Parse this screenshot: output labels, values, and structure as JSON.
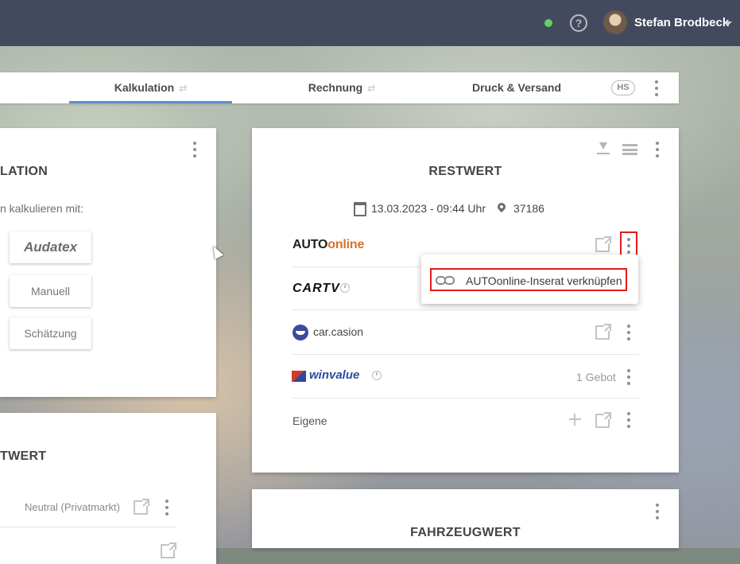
{
  "header": {
    "user_name": "Stefan Brodbeck",
    "help_symbol": "?",
    "status_color": "#5fd35f"
  },
  "tabs": [
    {
      "label": "Kalkulation",
      "icon": "⇄",
      "active": true
    },
    {
      "label": "Rechnung",
      "icon": "⇄",
      "active": false
    },
    {
      "label": "Druck & Versand",
      "active": false
    }
  ],
  "tabbar": {
    "badge": "HS"
  },
  "kalkulation_card": {
    "title": "LATION",
    "subtitle": "n kalkulieren mit:",
    "buttons": [
      "Audatex",
      "Manuell",
      "Schätzung"
    ]
  },
  "restwert_lower_card": {
    "title": "TWERT",
    "row_label": "Neutral (Privatmarkt)"
  },
  "restwert_card": {
    "title": "RESTWERT",
    "date": "13.03.2023 - 09:44 Uhr",
    "postal_code": "37186",
    "providers": [
      {
        "name_part1": "AUTO",
        "name_part2": "online"
      },
      {
        "name": "CARTV"
      },
      {
        "name": "car.casion"
      },
      {
        "name": "winvalue",
        "value": "1 Gebot"
      },
      {
        "name": "Eigene"
      }
    ]
  },
  "popup": {
    "label": "AUTOonline-Inserat verknüpfen"
  },
  "fahrzeugwert_card": {
    "title": "FAHRZEUGWERT"
  },
  "colors": {
    "topbar": "#444a5e",
    "accent": "#5e8ecd",
    "highlight": "#e01b1b",
    "autoonline_orange": "#d5702a"
  }
}
